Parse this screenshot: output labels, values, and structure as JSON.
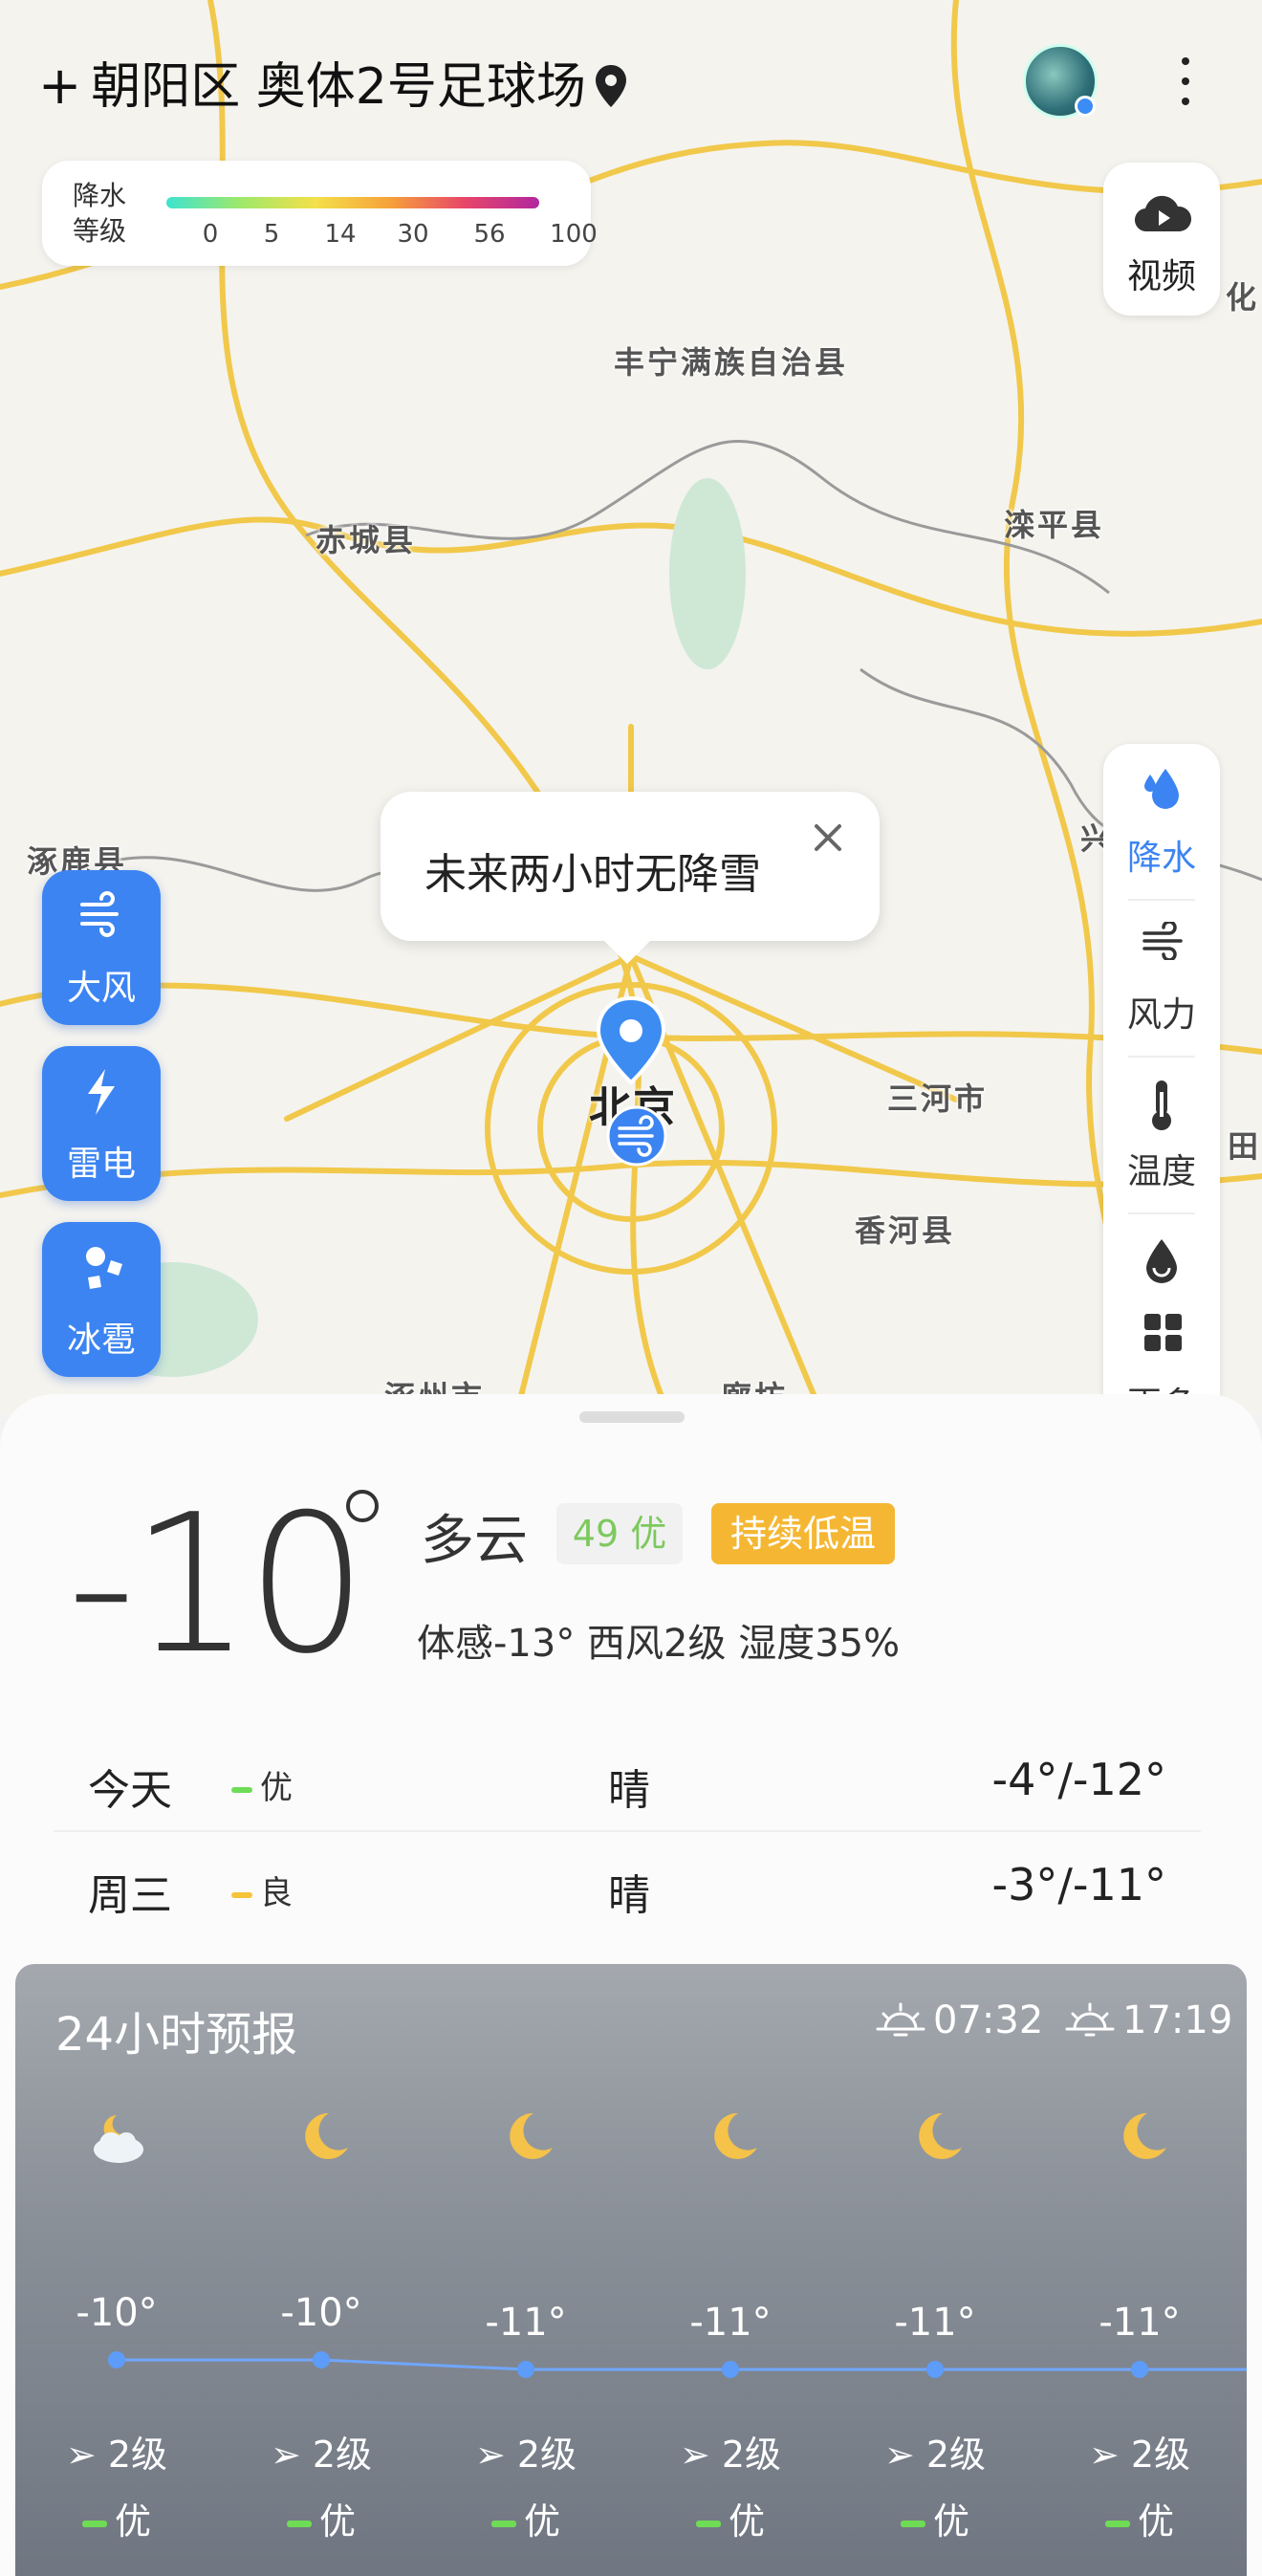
{
  "header": {
    "location": "朝阳区 奥体2号足球场",
    "add_icon": "plus-icon",
    "location_icon": "map-pin-icon",
    "more_icon": "more-vertical-icon"
  },
  "legend": {
    "title": "降水等级",
    "ticks": [
      "0",
      "5",
      "14",
      "30",
      "56",
      "100"
    ]
  },
  "map": {
    "video_label": "视频",
    "places": [
      "丰宁满族自治县",
      "赤城县",
      "滦平县",
      "涿鹿县",
      "三河市",
      "香河县",
      "北京",
      "涿州市",
      "廊坊",
      "化",
      "兴",
      "田"
    ],
    "popup_text": "未来两小时无降雪",
    "left_buttons": [
      {
        "label": "大风",
        "icon": "wind-icon"
      },
      {
        "label": "雷电",
        "icon": "lightning-icon"
      },
      {
        "label": "冰雹",
        "icon": "hail-icon"
      }
    ],
    "layers": [
      {
        "label": "降水",
        "icon": "raindrop-icon",
        "active": true
      },
      {
        "label": "风力",
        "icon": "wind-icon",
        "active": false
      },
      {
        "label": "温度",
        "icon": "thermometer-icon",
        "active": false
      },
      {
        "label": "",
        "icon": "humidity-icon",
        "active": false
      },
      {
        "label": "更多",
        "icon": "grid-icon",
        "active": false
      }
    ]
  },
  "current": {
    "temp": "-10",
    "condition": "多云",
    "aqi": "49 优",
    "alert": "持续低温",
    "detail": "体感-13° 西风2级 湿度35%"
  },
  "daily": [
    {
      "day": "今天",
      "aq": "优",
      "aq_color": "#6fdc55",
      "weather": "晴",
      "temp": "-4°/-12°"
    },
    {
      "day": "周三",
      "aq": "良",
      "aq_color": "#f5c43a",
      "weather": "晴",
      "temp": "-3°/-11°"
    }
  ],
  "hourly": {
    "title": "24小时预报",
    "sunrise": "07:32",
    "sunset": "17:19",
    "items": [
      {
        "icon": "cloudy-night-icon",
        "temp": "-10°",
        "t": -10,
        "wind": "2级",
        "aq": "优"
      },
      {
        "icon": "moon-icon",
        "temp": "-10°",
        "t": -10,
        "wind": "2级",
        "aq": "优"
      },
      {
        "icon": "moon-icon",
        "temp": "-11°",
        "t": -11,
        "wind": "2级",
        "aq": "优"
      },
      {
        "icon": "moon-icon",
        "temp": "-11°",
        "t": -11,
        "wind": "2级",
        "aq": "优"
      },
      {
        "icon": "moon-icon",
        "temp": "-11°",
        "t": -11,
        "wind": "2级",
        "aq": "优"
      },
      {
        "icon": "moon-icon",
        "temp": "-11°",
        "t": -11,
        "wind": "2级",
        "aq": "优"
      }
    ]
  }
}
